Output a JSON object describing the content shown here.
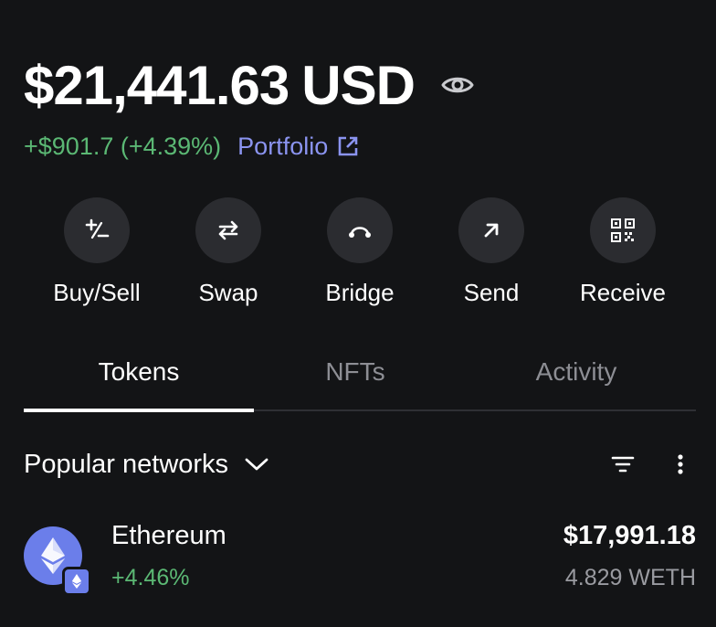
{
  "balance": {
    "amount": "$21,441.63",
    "currency": "USD",
    "change": "+$901.7 (+4.39%)",
    "portfolio_link": "Portfolio"
  },
  "actions": [
    {
      "label": "Buy/Sell",
      "icon": "plus-minus-icon"
    },
    {
      "label": "Swap",
      "icon": "swap-arrows-icon"
    },
    {
      "label": "Bridge",
      "icon": "bridge-icon"
    },
    {
      "label": "Send",
      "icon": "arrow-up-right-icon"
    },
    {
      "label": "Receive",
      "icon": "qr-code-icon"
    }
  ],
  "tabs": [
    {
      "label": "Tokens",
      "active": true
    },
    {
      "label": "NFTs",
      "active": false
    },
    {
      "label": "Activity",
      "active": false
    }
  ],
  "networks": {
    "label": "Popular networks"
  },
  "tokens": [
    {
      "name": "Ethereum",
      "change": "+4.46%",
      "fiat": "$17,991.18",
      "amount": "4.829 WETH",
      "icon": "ethereum-icon"
    }
  ],
  "colors": {
    "background": "#131416",
    "positive": "#5bb874",
    "link": "#8b94f0",
    "button_bg": "#2b2c30",
    "eth_brand": "#6b7eea"
  }
}
